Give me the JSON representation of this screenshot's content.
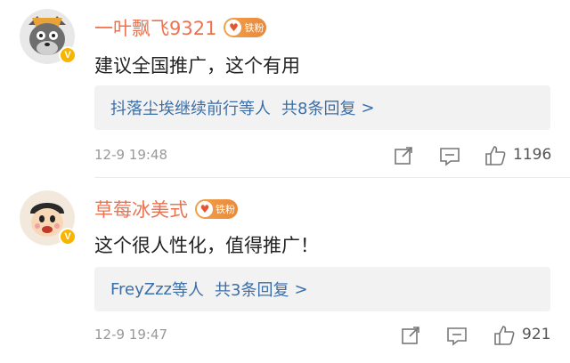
{
  "comments": [
    {
      "username": "一叶飘飞9321",
      "fan_badge": "铁粉",
      "avatar": "gray-wolf-avatar-icon",
      "verified": "V",
      "text": "建议全国推广，这个有用",
      "replies": {
        "names": "抖落尘埃继续前行",
        "mid": "等人",
        "count": "共8条回复",
        "arrow": ">"
      },
      "time": "12-9 19:48",
      "likes": "1196"
    },
    {
      "username": "草莓冰美式",
      "fan_badge": "铁粉",
      "avatar": "crayon-boy-avatar-icon",
      "verified": "V",
      "text": "这个很人性化，值得推广！",
      "replies": {
        "names": "FreyZzz",
        "mid": "等人",
        "count": "共3条回复",
        "arrow": ">"
      },
      "time": "12-9 19:47",
      "likes": "921"
    }
  ],
  "colors": {
    "username": "#eb7350",
    "link": "#3a6ea8",
    "meta": "#999999",
    "badge": "#f7b500"
  }
}
